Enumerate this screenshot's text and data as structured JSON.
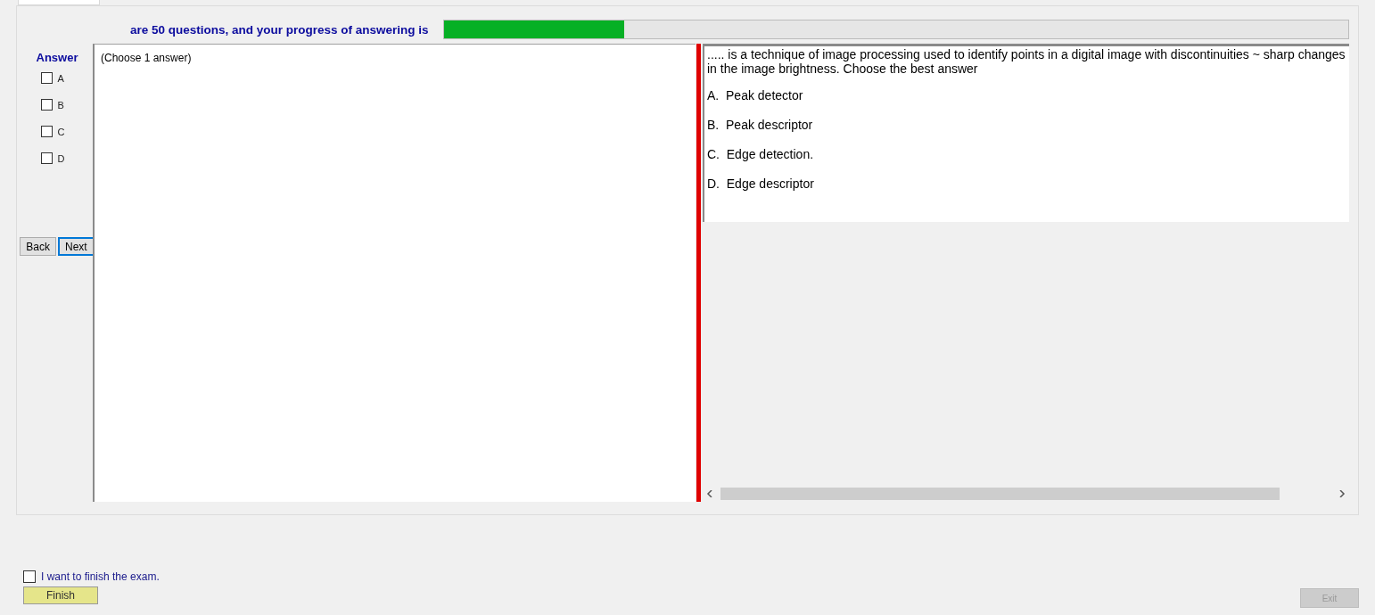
{
  "header": {
    "text": "are 50 questions, and your progress of answering is",
    "progress": {
      "level": 0.2
    }
  },
  "answer_panel": {
    "title": "Answer",
    "options": [
      {
        "label": "A",
        "checked": false
      },
      {
        "label": "B",
        "checked": false
      },
      {
        "label": "C",
        "checked": false
      },
      {
        "label": "D",
        "checked": false
      }
    ],
    "buttons": [
      {
        "label": "Back",
        "focused": false
      },
      {
        "label": "Next",
        "focused": true
      }
    ]
  },
  "answer_area": {
    "hint": "(Choose 1 answer)"
  },
  "question": {
    "text": "..... is a technique of image processing used to identify points in a digital image with discontinuities ~ sharp changes in the image brightness. Choose the best answer",
    "choices": [
      "A.  Peak detector",
      "B.  Peak descriptor",
      "C.  Edge detection.",
      "D.  Edge descriptor"
    ]
  },
  "footer": {
    "finish_check": {
      "label": "I want to finish the exam.",
      "checked": false
    },
    "finish_button": {
      "label": "Finish",
      "disabled": false
    },
    "exit_button": {
      "label": "Exit",
      "disabled": true
    }
  }
}
